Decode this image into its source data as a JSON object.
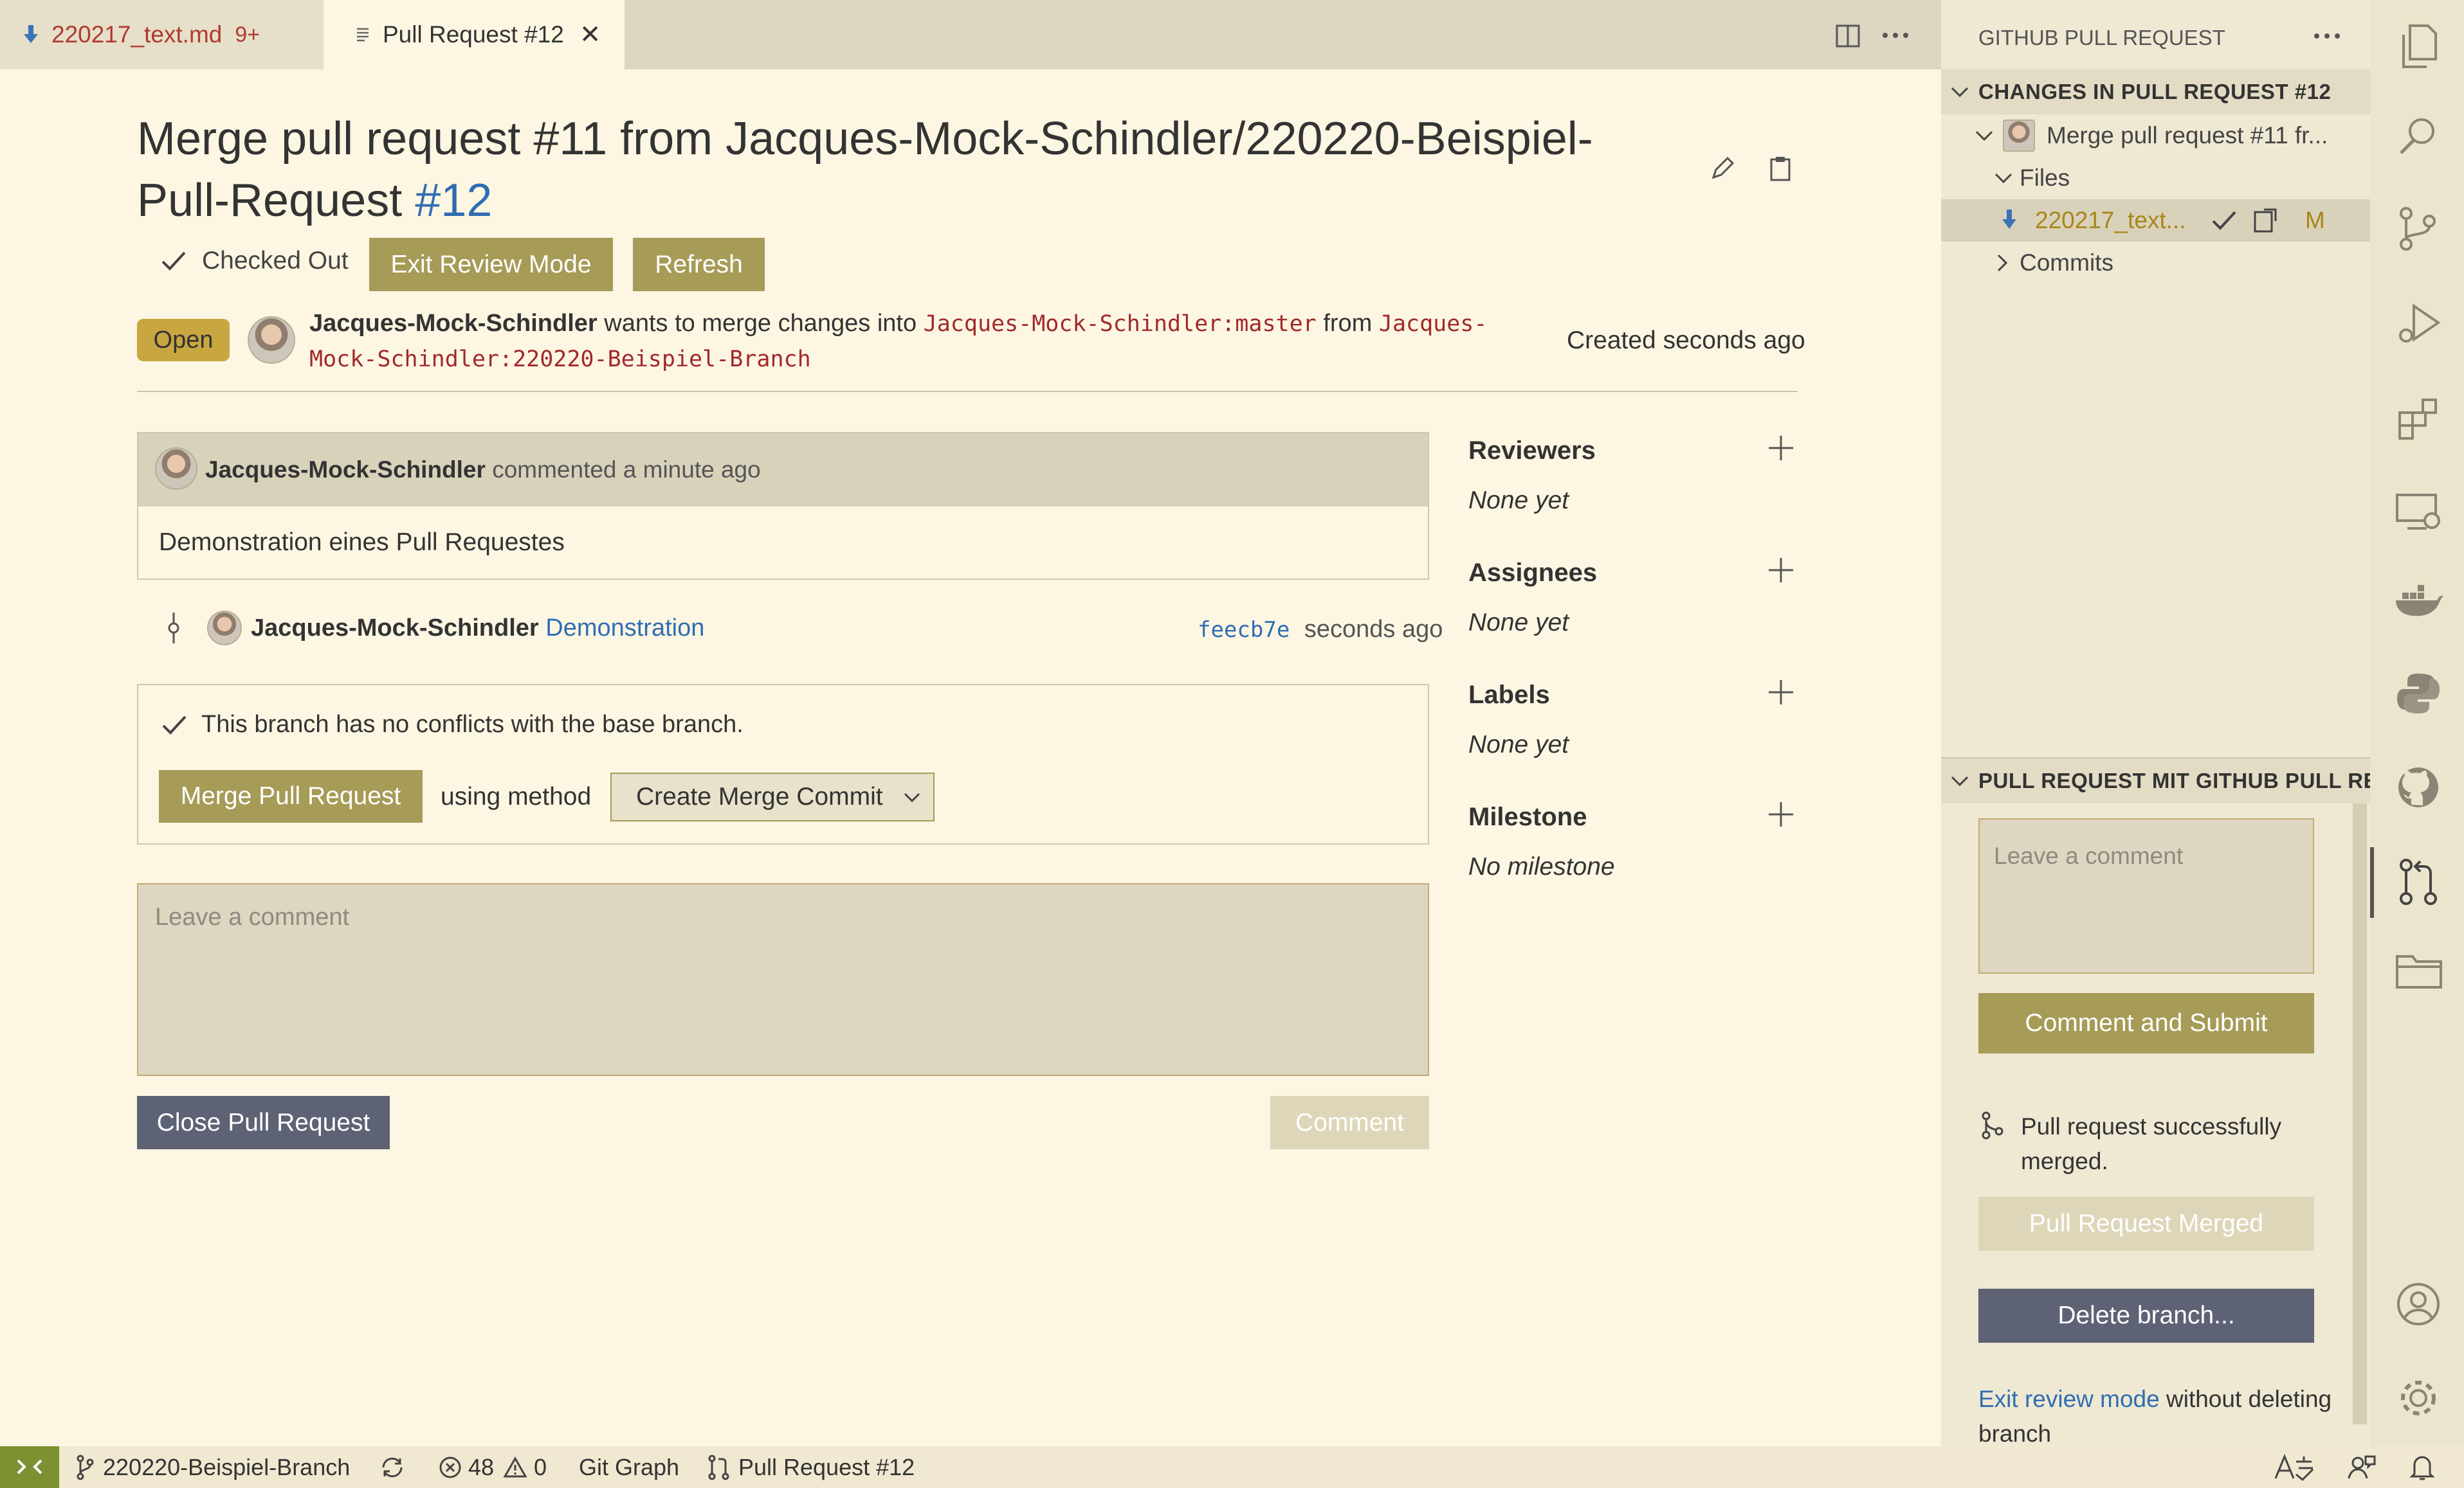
{
  "tabs": {
    "file_tab": {
      "label": "220217_text.md",
      "count": "9+"
    },
    "pr_tab": {
      "label": "Pull Request #12"
    }
  },
  "pr": {
    "title": "Merge pull request #11 from Jacques-Mock-Schindler/220220-Beispiel-Pull-Request",
    "number": "#12",
    "checked_out": "Checked Out",
    "exit_review": "Exit Review Mode",
    "refresh": "Refresh",
    "status": "Open",
    "author": "Jacques-Mock-Schindler",
    "wants_text": "wants to merge changes into",
    "target_branch": "Jacques-Mock-Schindler:master",
    "from_text": "from",
    "source_branch": "Jacques-Mock-Schindler:220220-Beispiel-Branch",
    "created": "Created seconds ago"
  },
  "comment": {
    "author": "Jacques-Mock-Schindler",
    "meta": "commented a minute ago",
    "body": "Demonstration eines Pull Requestes"
  },
  "commit": {
    "author": "Jacques-Mock-Schindler",
    "message": "Demonstration",
    "sha": "feecb7e",
    "time": "seconds ago"
  },
  "merge": {
    "no_conflicts": "This branch has no conflicts with the base branch.",
    "merge_button": "Merge Pull Request",
    "using_method": "using method",
    "method": "Create Merge Commit"
  },
  "composer": {
    "placeholder": "Leave a comment",
    "close_button": "Close Pull Request",
    "comment_button": "Comment"
  },
  "side": {
    "reviewers": "Reviewers",
    "reviewers_value": "None yet",
    "assignees": "Assignees",
    "assignees_value": "None yet",
    "labels": "Labels",
    "labels_value": "None yet",
    "milestone": "Milestone",
    "milestone_value": "No milestone"
  },
  "sidebar": {
    "title": "GITHUB PULL REQUEST",
    "changes_header": "CHANGES IN PULL REQUEST #12",
    "pr_item": "Merge pull request #11 fr...",
    "files_label": "Files",
    "file_item": "220217_text...",
    "file_status": "M",
    "commits_label": "Commits",
    "section2_header": "PULL REQUEST MIT GITHUB PULL RE...",
    "comment_placeholder": "Leave a comment",
    "comment_submit": "Comment and Submit",
    "merged_msg": "Pull request successfully merged.",
    "merged_button": "Pull Request Merged",
    "delete_branch": "Delete branch...",
    "exit_review_link": "Exit review mode",
    "exit_review_rest": "without deleting branch"
  },
  "statusbar": {
    "branch": "220220-Beispiel-Branch",
    "errors": "48",
    "warnings": "0",
    "git_graph": "Git Graph",
    "pull_request": "Pull Request #12"
  },
  "colors": {
    "background": "#fdf6e3",
    "accent_olive": "#a69b57",
    "slate_button": "#5d6275",
    "link_blue": "#2f6db3",
    "code_red": "#a1292b",
    "remote_green": "#7c9131"
  }
}
